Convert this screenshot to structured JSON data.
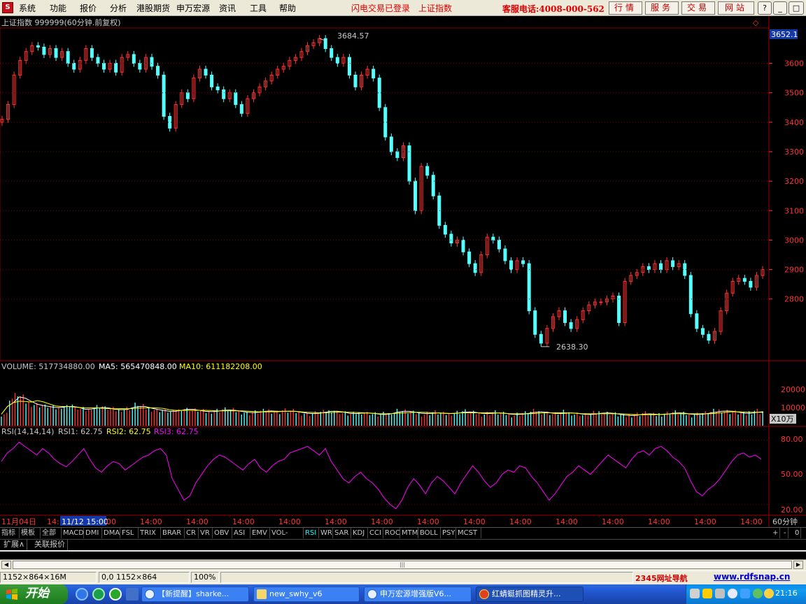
{
  "menu": {
    "items": [
      "系统",
      "功能",
      "报价",
      "分析",
      "港股期货",
      "申万宏源",
      "资讯",
      "工具",
      "帮助"
    ],
    "promo_login": "闪电交易已登录",
    "promo_index": "上证指数",
    "hotline": "客服电话:4008-000-562",
    "buttons": [
      "行情",
      "服务",
      "交易",
      "网站"
    ],
    "window_controls": [
      "?",
      "_",
      "□",
      "×"
    ]
  },
  "chart": {
    "title": "上证指数 999999(60分钟.前复权)",
    "current_price_tag": "3652.1",
    "high_label": "3684.57",
    "low_label": "2638.30",
    "price_axis": [
      "3600",
      "3500",
      "3400",
      "3300",
      "3200",
      "3100",
      "3000",
      "2900",
      "2800"
    ],
    "volume_legend": {
      "volume": "VOLUME: 517734880.00",
      "ma5": "MA5: 565470848.00",
      "ma10": "MA10: 611182208.00"
    },
    "volume_axis": [
      "20000",
      "10000"
    ],
    "volume_unit": "X10万",
    "rsi_legend": {
      "name": "RSI(14,14,14)",
      "rsi1": "RSI1: 62.75",
      "rsi2": "RSI2: 62.75",
      "rsi3": "RSI3: 62.75"
    },
    "rsi_axis": [
      "80.00",
      "50.00",
      "20.00"
    ],
    "date_axis": {
      "first": "11月04日",
      "first_time": "14:",
      "cursor": "11/12 15:00",
      "after_cursor": "00",
      "ticks": [
        "14:00",
        "14:00",
        "14:00",
        "14:00",
        "14:00",
        "14:00",
        "14:00",
        "14:00",
        "14:00",
        "14:00",
        "14:00",
        "14:00",
        "14:00",
        "14:00"
      ],
      "period": "60分钟"
    },
    "colors": {
      "up": "#ff3232",
      "down": "#54ffff",
      "ma5": "#ffffff",
      "ma10": "#ffff00",
      "rsi": "#ff00ff",
      "grid": "#800000"
    }
  },
  "indicator_tabs": [
    "指标",
    "模板",
    "全部",
    "MACD",
    "DMI",
    "DMA",
    "FSL",
    "TRIX",
    "BRAR",
    "CR",
    "VR",
    "OBV",
    "ASI",
    "EMV",
    "VOL-TDX",
    "RSI",
    "WR",
    "SAR",
    "KDJ",
    "CCI",
    "ROC",
    "MTM",
    "BOLL",
    "PSY",
    "MCST"
  ],
  "tab_controls": [
    "+",
    "-",
    "0"
  ],
  "sub_tabs": [
    "扩展∧",
    "关联报价"
  ],
  "statusbar": {
    "dims": "1152×864×16M",
    "coords": "0,0 1152×864",
    "zoom": "100%",
    "nav_site": "2345网址导航",
    "url": "www.rdfsnap.cn"
  },
  "taskbar": {
    "start": "开始",
    "tasks": [
      "【新提醒】sharke...",
      "new_swhy_v6",
      "申万宏源增强版V6...",
      "红蜻蜓抓图精灵升..."
    ],
    "clock": "21:16"
  },
  "chart_data": {
    "type": "candlestick",
    "price_ylim": [
      2600,
      3720
    ],
    "high": 3684.57,
    "low": 2638.3,
    "last": 3652.1,
    "close_path": [
      3410,
      3460,
      3560,
      3610,
      3640,
      3660,
      3655,
      3630,
      3650,
      3620,
      3640,
      3600,
      3580,
      3610,
      3650,
      3620,
      3600,
      3580,
      3600,
      3570,
      3620,
      3630,
      3600,
      3580,
      3620,
      3590,
      3560,
      3420,
      3380,
      3460,
      3500,
      3480,
      3550,
      3580,
      3560,
      3520,
      3510,
      3480,
      3500,
      3460,
      3430,
      3480,
      3500,
      3520,
      3540,
      3560,
      3580,
      3590,
      3610,
      3620,
      3640,
      3660,
      3670,
      3684,
      3650,
      3620,
      3600,
      3620,
      3560,
      3520,
      3560,
      3580,
      3550,
      3450,
      3350,
      3300,
      3280,
      3320,
      3200,
      3100,
      3250,
      3220,
      3150,
      3050,
      3020,
      2990,
      3000,
      2960,
      2920,
      2890,
      2950,
      3010,
      3000,
      2970,
      2930,
      2900,
      2930,
      2920,
      2760,
      2680,
      2650,
      2700,
      2740,
      2760,
      2720,
      2700,
      2730,
      2760,
      2780,
      2790,
      2790,
      2800,
      2810,
      2720,
      2860,
      2880,
      2890,
      2910,
      2900,
      2920,
      2900,
      2930,
      2910,
      2920,
      2880,
      2750,
      2700,
      2680,
      2660,
      2690,
      2760,
      2820,
      2860,
      2870,
      2860,
      2840,
      2880,
      2900
    ],
    "volume_ylim": [
      0,
      28000
    ],
    "rsi_ylim": [
      10,
      90
    ],
    "rsi_path": [
      60,
      68,
      72,
      78,
      74,
      70,
      66,
      72,
      68,
      62,
      58,
      55,
      60,
      66,
      72,
      62,
      54,
      50,
      56,
      60,
      58,
      52,
      56,
      60,
      64,
      66,
      70,
      72,
      66,
      44,
      34,
      24,
      28,
      40,
      48,
      56,
      62,
      66,
      64,
      60,
      56,
      52,
      58,
      62,
      54,
      50,
      56,
      60,
      62,
      68,
      70,
      72,
      74,
      70,
      66,
      72,
      60,
      52,
      44,
      40,
      46,
      50,
      44,
      40,
      34,
      26,
      20,
      16,
      24,
      36,
      44,
      38,
      30,
      40,
      46,
      42,
      36,
      30,
      40,
      48,
      56,
      50,
      42,
      36,
      40,
      48,
      52,
      50,
      56,
      54,
      46,
      40,
      32,
      24,
      30,
      38,
      46,
      50,
      56,
      52,
      48,
      54,
      60,
      66,
      62,
      58,
      54,
      62,
      68,
      70,
      66,
      72,
      74,
      70,
      64,
      60,
      54,
      42,
      32,
      28,
      34,
      38,
      44,
      52,
      60,
      66,
      68,
      64,
      66,
      62
    ],
    "volume_samples": [
      6000,
      14000,
      16000,
      15000,
      12000,
      11000,
      10500,
      10000,
      9500,
      9000,
      10000,
      11000,
      9000,
      8500,
      8000,
      9500,
      10000,
      9000,
      8500,
      8000,
      8500,
      9000,
      11000,
      10000,
      9000,
      8500,
      8000,
      7500,
      7000,
      8000,
      9000,
      8500,
      8000,
      7500,
      7000,
      7500,
      8000,
      8500,
      8000,
      7500,
      7000,
      6500,
      7000,
      7500,
      8000,
      7500,
      7000,
      8000,
      7500,
      7000,
      6500,
      6000,
      6500,
      7000,
      7500,
      8000,
      7000,
      6500,
      6000,
      6500,
      7000,
      6500,
      6000,
      5500,
      6000,
      7000,
      8000,
      7500,
      7000,
      6500,
      6000,
      6500,
      7000,
      6500,
      6000,
      6500,
      7000,
      7500,
      7000,
      6500,
      6000,
      6500,
      7000,
      6500,
      6000,
      5500,
      6000,
      6500,
      7000,
      7500,
      7000,
      6500,
      6000,
      6500,
      7000,
      6500,
      6000,
      5500,
      6000,
      6500,
      7000,
      6500,
      6000,
      5500,
      5000,
      5500,
      6000,
      6500,
      6000,
      5500,
      6000,
      6500,
      7000,
      6500,
      6000,
      5500,
      6000,
      6500,
      7000,
      7500,
      8000,
      7500,
      7000,
      6500,
      6000,
      7000,
      8000,
      7000
    ]
  }
}
